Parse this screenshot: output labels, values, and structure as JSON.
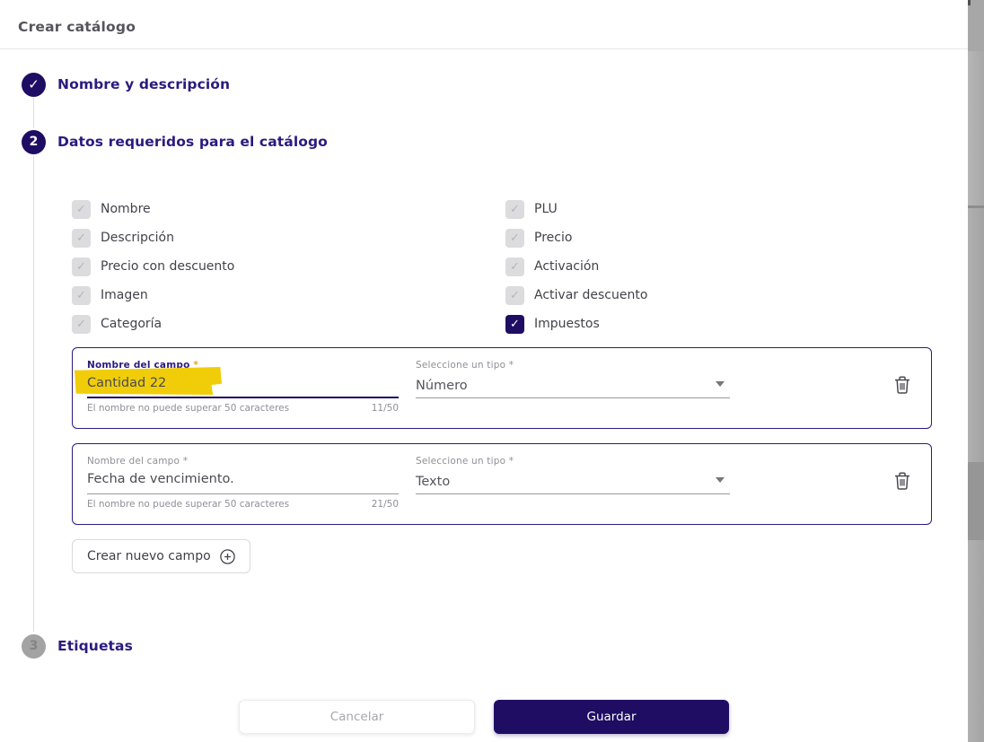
{
  "modal": {
    "title": "Crear catálogo"
  },
  "steps": [
    {
      "label": "Nombre y descripción",
      "state": "completed"
    },
    {
      "number": "2",
      "label": "Datos requeridos para el catálogo",
      "state": "active"
    },
    {
      "number": "3",
      "label": "Etiquetas",
      "state": "pending"
    }
  ],
  "step2": {
    "checkboxes_left": [
      {
        "label": "Nombre",
        "checked": true,
        "disabled": true
      },
      {
        "label": "Descripción",
        "checked": true,
        "disabled": true
      },
      {
        "label": "Precio con descuento",
        "checked": true,
        "disabled": true
      },
      {
        "label": "Imagen",
        "checked": true,
        "disabled": true
      },
      {
        "label": "Categoría",
        "checked": true,
        "disabled": true
      }
    ],
    "checkboxes_right": [
      {
        "label": "PLU",
        "checked": true,
        "disabled": true
      },
      {
        "label": "Precio",
        "checked": true,
        "disabled": true
      },
      {
        "label": "Activación",
        "checked": true,
        "disabled": true
      },
      {
        "label": "Activar descuento",
        "checked": true,
        "disabled": true
      },
      {
        "label": "Impuestos",
        "checked": true,
        "disabled": false
      }
    ],
    "create_field_label": "Crear nuevo campo"
  },
  "fields": [
    {
      "name_label": "Nombre del campo",
      "required_mark": "*",
      "value": "Cantidad 22",
      "helper": "El nombre no puede superar 50 caracteres",
      "counter": "11/50",
      "type_label": "Seleccione un tipo",
      "type_value": "Número",
      "focused": true,
      "highlighted": true
    },
    {
      "name_label": "Nombre del campo",
      "required_mark": "*",
      "value": "Fecha de vencimiento.",
      "helper": "El nombre no puede superar 50 caracteres",
      "counter": "21/50",
      "type_label": "Seleccione un tipo",
      "type_value": "Texto",
      "focused": false,
      "highlighted": false
    }
  ],
  "footer": {
    "cancel_label": "Cancelar",
    "save_label": "Guardar"
  },
  "icons": {
    "check": "✓"
  },
  "colors": {
    "primary_navy": "#1f0d63",
    "step_indigo": "#2c1b7e",
    "required_amber": "#eaa221",
    "highlight_yellow": "#f0cd08",
    "disabled_checkbox": "#dcdcdf"
  }
}
